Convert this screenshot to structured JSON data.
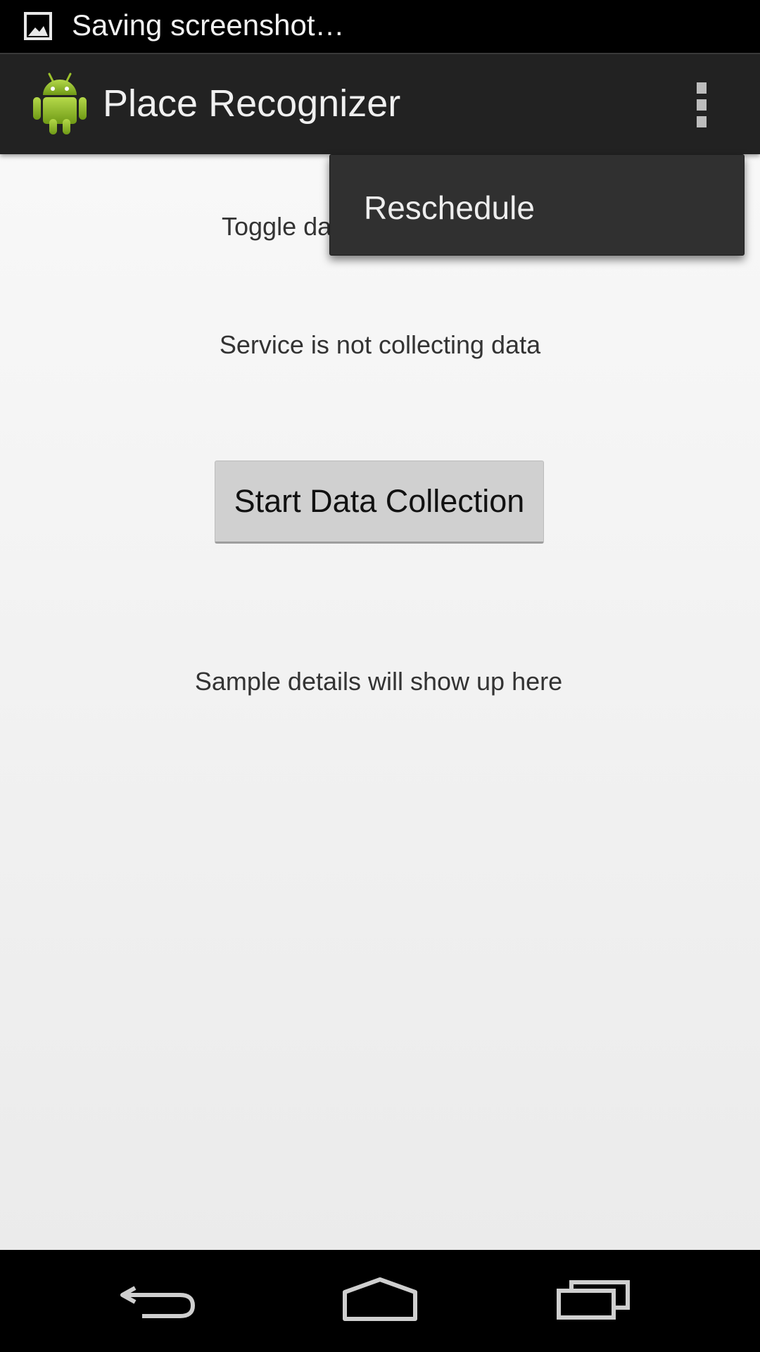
{
  "status_bar": {
    "notification_icon": "image-icon",
    "text": "Saving screenshot…"
  },
  "action_bar": {
    "app_icon": "android-robot-icon",
    "title": "Place Recognizer",
    "overflow_icon": "overflow-menu-icon"
  },
  "popup_menu": {
    "items": [
      {
        "label": "Reschedule"
      }
    ]
  },
  "main": {
    "toggle_label": "Toggle da",
    "service_status": "Service is not collecting data",
    "start_button_label": "Start Data Collection",
    "sample_details": "Sample details will show up here"
  },
  "nav_bar": {
    "back_icon": "back-icon",
    "home_icon": "home-icon",
    "recents_icon": "recent-apps-icon"
  },
  "colors": {
    "action_bar_bg": "#222222",
    "content_bg": "#f4f4f4",
    "button_bg": "#d0d0d0",
    "android_green": "#97c024"
  }
}
